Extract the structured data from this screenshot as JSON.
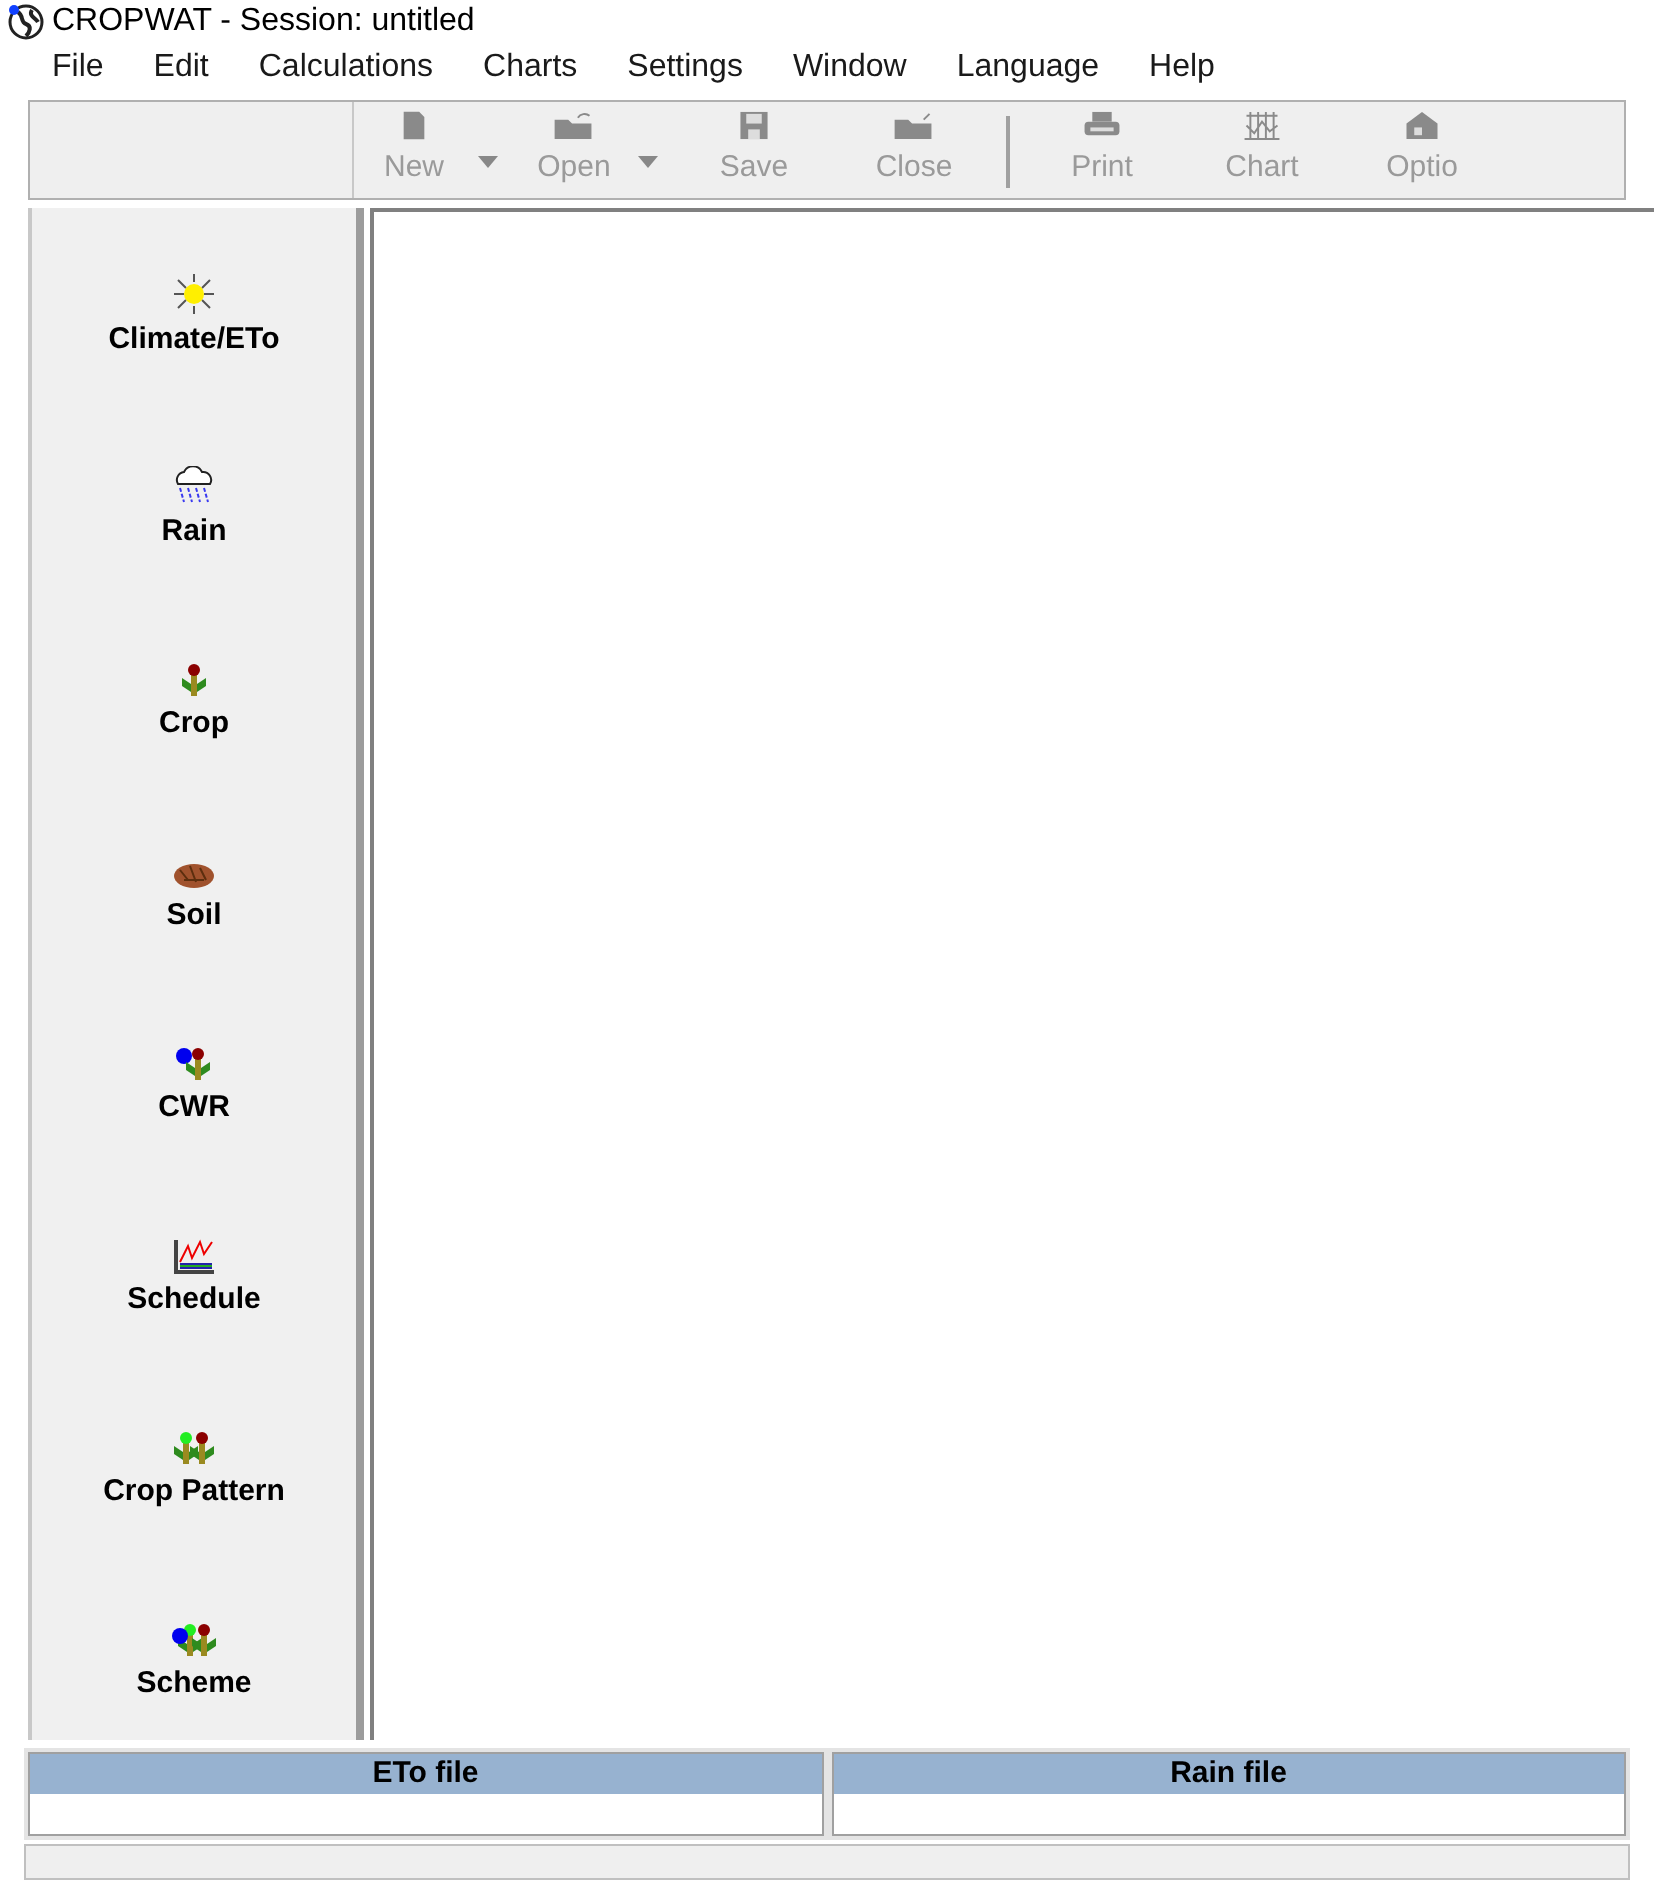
{
  "window": {
    "title": "CROPWAT - Session: untitled"
  },
  "menu": [
    "File",
    "Edit",
    "Calculations",
    "Charts",
    "Settings",
    "Window",
    "Language",
    "Help"
  ],
  "toolbar": [
    {
      "label": "New",
      "kind": "new",
      "dropdown": true,
      "disabled": true
    },
    {
      "label": "Open",
      "kind": "open",
      "dropdown": true,
      "disabled": true
    },
    {
      "label": "Save",
      "kind": "save",
      "dropdown": false,
      "disabled": true
    },
    {
      "label": "Close",
      "kind": "close",
      "dropdown": false,
      "disabled": true
    },
    {
      "kind": "separator"
    },
    {
      "label": "Print",
      "kind": "print",
      "dropdown": false,
      "disabled": true
    },
    {
      "label": "Chart",
      "kind": "chart",
      "dropdown": false,
      "disabled": true
    },
    {
      "label": "Optio",
      "kind": "options",
      "dropdown": false,
      "disabled": true
    }
  ],
  "sidebar": {
    "items": [
      {
        "label": "Climate/ETo",
        "kind": "sun"
      },
      {
        "label": "Rain",
        "kind": "rain"
      },
      {
        "label": "Crop",
        "kind": "crop"
      },
      {
        "label": "Soil",
        "kind": "soil"
      },
      {
        "label": "CWR",
        "kind": "cwr"
      },
      {
        "label": "Schedule",
        "kind": "schedule"
      },
      {
        "label": "Crop Pattern",
        "kind": "pattern"
      },
      {
        "label": "Scheme",
        "kind": "scheme"
      }
    ]
  },
  "file_panels": [
    {
      "heading": "ETo file"
    },
    {
      "heading": "Rain file"
    }
  ]
}
